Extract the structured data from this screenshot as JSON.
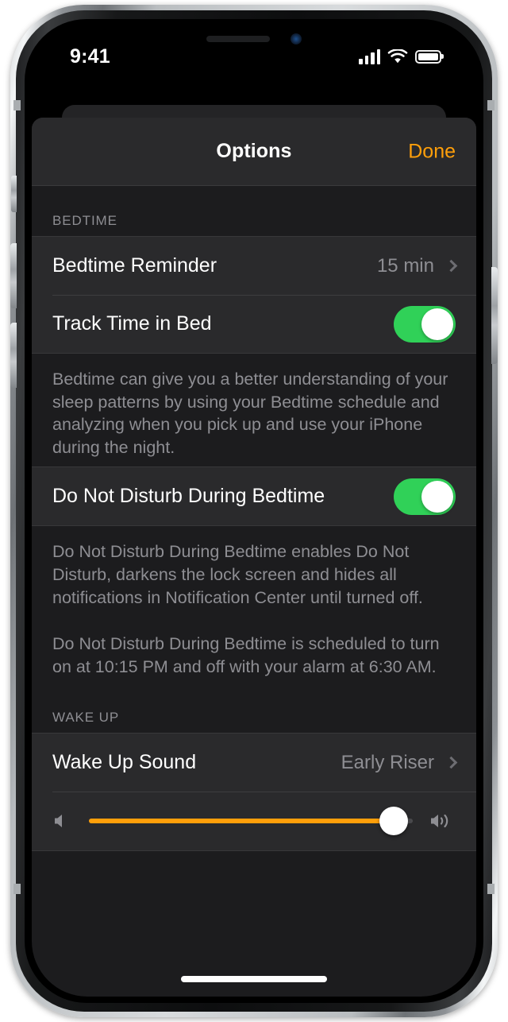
{
  "status_bar": {
    "time": "9:41",
    "signal_icon": "cellular-signal-icon",
    "wifi_icon": "wifi-icon",
    "battery_icon": "battery-icon"
  },
  "nav": {
    "title": "Options",
    "done_label": "Done"
  },
  "colors": {
    "accent_orange": "#ff9f0a",
    "toggle_on_green": "#30d158",
    "sheet_background": "#1c1c1e",
    "row_background": "#2a2a2c",
    "secondary_text": "#8e8e93"
  },
  "sections": [
    {
      "header": "BEDTIME",
      "rows": [
        {
          "label": "Bedtime Reminder",
          "value": "15 min",
          "accessory": "chevron-right-icon"
        },
        {
          "label": "Track Time in Bed",
          "toggle_state": "on"
        }
      ],
      "footer": "Bedtime can give you a better understanding of your sleep patterns by using your Bedtime schedule and analyzing when you pick up and use your iPhone during the night."
    },
    {
      "header": "",
      "rows": [
        {
          "label": "Do Not Disturb During Bedtime",
          "toggle_state": "on"
        }
      ],
      "footer": "Do Not Disturb During Bedtime enables Do Not Disturb, darkens the lock screen and hides all notifications in Notification Center until turned off.",
      "footer_second": "Do Not Disturb During Bedtime is scheduled to turn on at 10:15 PM and off with your alarm at 6:30 AM."
    },
    {
      "header": "WAKE UP",
      "rows": [
        {
          "label": "Wake Up Sound",
          "value": "Early Riser",
          "accessory": "chevron-right-icon"
        }
      ],
      "volume": {
        "min_icon": "speaker-low-icon",
        "max_icon": "speaker-high-icon",
        "value_percent": 94
      }
    }
  ],
  "home_indicator": "home-indicator"
}
